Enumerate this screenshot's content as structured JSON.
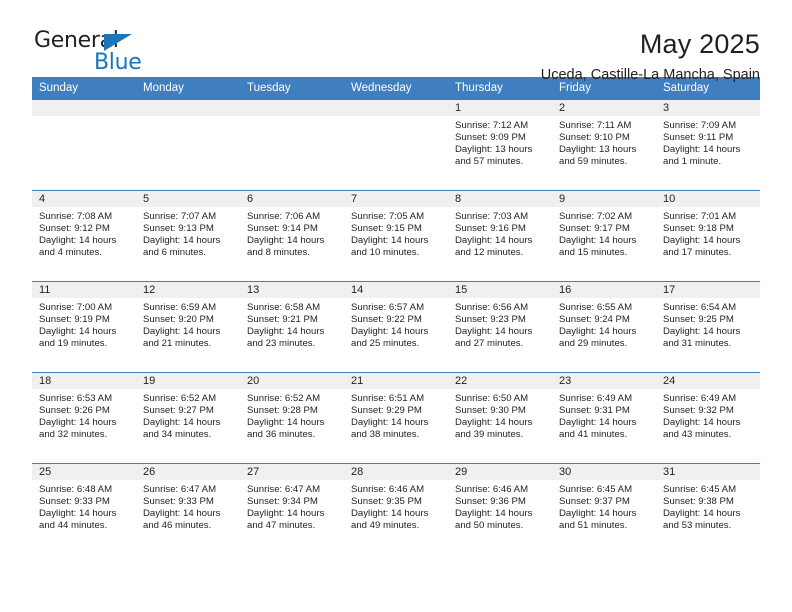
{
  "brand": {
    "name_part1": "General",
    "name_part2": "Blue",
    "accent_color": "#1b75bb"
  },
  "header": {
    "title": "May 2025",
    "location": "Uceda, Castille-La Mancha, Spain"
  },
  "calendar": {
    "header_bg": "#3f7fbf",
    "weekday_headers": [
      "Sunday",
      "Monday",
      "Tuesday",
      "Wednesday",
      "Thursday",
      "Friday",
      "Saturday"
    ],
    "weeks": [
      [
        {
          "day": "",
          "empty": true
        },
        {
          "day": "",
          "empty": true
        },
        {
          "day": "",
          "empty": true
        },
        {
          "day": "",
          "empty": true
        },
        {
          "day": "1",
          "sunrise": "Sunrise: 7:12 AM",
          "sunset": "Sunset: 9:09 PM",
          "daylight": "Daylight: 13 hours and 57 minutes."
        },
        {
          "day": "2",
          "sunrise": "Sunrise: 7:11 AM",
          "sunset": "Sunset: 9:10 PM",
          "daylight": "Daylight: 13 hours and 59 minutes."
        },
        {
          "day": "3",
          "sunrise": "Sunrise: 7:09 AM",
          "sunset": "Sunset: 9:11 PM",
          "daylight": "Daylight: 14 hours and 1 minute."
        }
      ],
      [
        {
          "day": "4",
          "sunrise": "Sunrise: 7:08 AM",
          "sunset": "Sunset: 9:12 PM",
          "daylight": "Daylight: 14 hours and 4 minutes."
        },
        {
          "day": "5",
          "sunrise": "Sunrise: 7:07 AM",
          "sunset": "Sunset: 9:13 PM",
          "daylight": "Daylight: 14 hours and 6 minutes."
        },
        {
          "day": "6",
          "sunrise": "Sunrise: 7:06 AM",
          "sunset": "Sunset: 9:14 PM",
          "daylight": "Daylight: 14 hours and 8 minutes."
        },
        {
          "day": "7",
          "sunrise": "Sunrise: 7:05 AM",
          "sunset": "Sunset: 9:15 PM",
          "daylight": "Daylight: 14 hours and 10 minutes."
        },
        {
          "day": "8",
          "sunrise": "Sunrise: 7:03 AM",
          "sunset": "Sunset: 9:16 PM",
          "daylight": "Daylight: 14 hours and 12 minutes."
        },
        {
          "day": "9",
          "sunrise": "Sunrise: 7:02 AM",
          "sunset": "Sunset: 9:17 PM",
          "daylight": "Daylight: 14 hours and 15 minutes."
        },
        {
          "day": "10",
          "sunrise": "Sunrise: 7:01 AM",
          "sunset": "Sunset: 9:18 PM",
          "daylight": "Daylight: 14 hours and 17 minutes."
        }
      ],
      [
        {
          "day": "11",
          "sunrise": "Sunrise: 7:00 AM",
          "sunset": "Sunset: 9:19 PM",
          "daylight": "Daylight: 14 hours and 19 minutes."
        },
        {
          "day": "12",
          "sunrise": "Sunrise: 6:59 AM",
          "sunset": "Sunset: 9:20 PM",
          "daylight": "Daylight: 14 hours and 21 minutes."
        },
        {
          "day": "13",
          "sunrise": "Sunrise: 6:58 AM",
          "sunset": "Sunset: 9:21 PM",
          "daylight": "Daylight: 14 hours and 23 minutes."
        },
        {
          "day": "14",
          "sunrise": "Sunrise: 6:57 AM",
          "sunset": "Sunset: 9:22 PM",
          "daylight": "Daylight: 14 hours and 25 minutes."
        },
        {
          "day": "15",
          "sunrise": "Sunrise: 6:56 AM",
          "sunset": "Sunset: 9:23 PM",
          "daylight": "Daylight: 14 hours and 27 minutes."
        },
        {
          "day": "16",
          "sunrise": "Sunrise: 6:55 AM",
          "sunset": "Sunset: 9:24 PM",
          "daylight": "Daylight: 14 hours and 29 minutes."
        },
        {
          "day": "17",
          "sunrise": "Sunrise: 6:54 AM",
          "sunset": "Sunset: 9:25 PM",
          "daylight": "Daylight: 14 hours and 31 minutes."
        }
      ],
      [
        {
          "day": "18",
          "sunrise": "Sunrise: 6:53 AM",
          "sunset": "Sunset: 9:26 PM",
          "daylight": "Daylight: 14 hours and 32 minutes."
        },
        {
          "day": "19",
          "sunrise": "Sunrise: 6:52 AM",
          "sunset": "Sunset: 9:27 PM",
          "daylight": "Daylight: 14 hours and 34 minutes."
        },
        {
          "day": "20",
          "sunrise": "Sunrise: 6:52 AM",
          "sunset": "Sunset: 9:28 PM",
          "daylight": "Daylight: 14 hours and 36 minutes."
        },
        {
          "day": "21",
          "sunrise": "Sunrise: 6:51 AM",
          "sunset": "Sunset: 9:29 PM",
          "daylight": "Daylight: 14 hours and 38 minutes."
        },
        {
          "day": "22",
          "sunrise": "Sunrise: 6:50 AM",
          "sunset": "Sunset: 9:30 PM",
          "daylight": "Daylight: 14 hours and 39 minutes."
        },
        {
          "day": "23",
          "sunrise": "Sunrise: 6:49 AM",
          "sunset": "Sunset: 9:31 PM",
          "daylight": "Daylight: 14 hours and 41 minutes."
        },
        {
          "day": "24",
          "sunrise": "Sunrise: 6:49 AM",
          "sunset": "Sunset: 9:32 PM",
          "daylight": "Daylight: 14 hours and 43 minutes."
        }
      ],
      [
        {
          "day": "25",
          "sunrise": "Sunrise: 6:48 AM",
          "sunset": "Sunset: 9:33 PM",
          "daylight": "Daylight: 14 hours and 44 minutes."
        },
        {
          "day": "26",
          "sunrise": "Sunrise: 6:47 AM",
          "sunset": "Sunset: 9:33 PM",
          "daylight": "Daylight: 14 hours and 46 minutes."
        },
        {
          "day": "27",
          "sunrise": "Sunrise: 6:47 AM",
          "sunset": "Sunset: 9:34 PM",
          "daylight": "Daylight: 14 hours and 47 minutes."
        },
        {
          "day": "28",
          "sunrise": "Sunrise: 6:46 AM",
          "sunset": "Sunset: 9:35 PM",
          "daylight": "Daylight: 14 hours and 49 minutes."
        },
        {
          "day": "29",
          "sunrise": "Sunrise: 6:46 AM",
          "sunset": "Sunset: 9:36 PM",
          "daylight": "Daylight: 14 hours and 50 minutes."
        },
        {
          "day": "30",
          "sunrise": "Sunrise: 6:45 AM",
          "sunset": "Sunset: 9:37 PM",
          "daylight": "Daylight: 14 hours and 51 minutes."
        },
        {
          "day": "31",
          "sunrise": "Sunrise: 6:45 AM",
          "sunset": "Sunset: 9:38 PM",
          "daylight": "Daylight: 14 hours and 53 minutes."
        }
      ]
    ]
  }
}
